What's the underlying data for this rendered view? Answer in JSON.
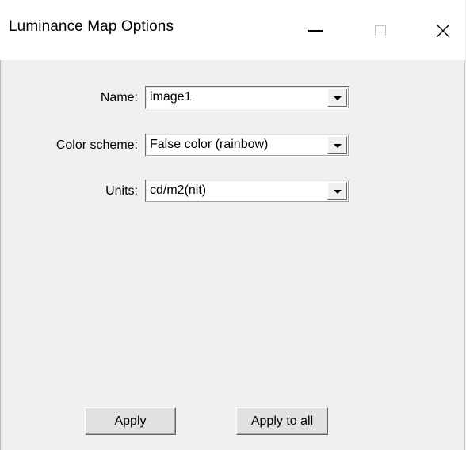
{
  "window": {
    "title": "Luminance Map Options",
    "minimize_glyph": "—",
    "close_glyph": "✕"
  },
  "fields": {
    "name": {
      "label": "Name:",
      "value": "image1"
    },
    "color_scheme": {
      "label": "Color scheme:",
      "value": "False color (rainbow)"
    },
    "units": {
      "label": "Units:",
      "value": "cd/m2(nit)"
    }
  },
  "buttons": {
    "apply_label": "Apply",
    "apply_all_label": "Apply to all"
  },
  "icons": {
    "minimize": "minimize-icon",
    "maximize": "maximize-icon",
    "close": "close-icon",
    "dropdown": "chevron-down-icon"
  }
}
